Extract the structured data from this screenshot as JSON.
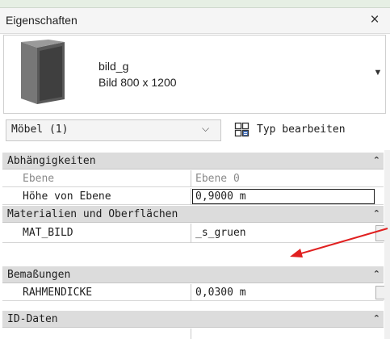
{
  "panel": {
    "title": "Eigenschaften",
    "close_glyph": "×"
  },
  "type_selector": {
    "family": "bild_g",
    "type": "Bild 800 x 1200",
    "dropdown_glyph": "▼"
  },
  "selection": {
    "filter_value": "Möbel (1)",
    "filter_arrow": "⌵",
    "edit_type_label": "Typ bearbeiten"
  },
  "sections": {
    "constraints": {
      "title": "Abhängigkeiten",
      "chevron": "⌃",
      "rows": [
        {
          "label": "Ebene",
          "value": "Ebene 0"
        },
        {
          "label": "Höhe von Ebene",
          "value": "0,9000 m"
        }
      ]
    },
    "materials": {
      "title": "Materialien und Oberflächen",
      "chevron": "⌃",
      "rows": [
        {
          "label": "MAT_BILD",
          "value": "_s_gruen"
        }
      ]
    },
    "dimensions": {
      "title": "Bemaßungen",
      "chevron": "⌃",
      "rows": [
        {
          "label": "RAHMENDICKE",
          "value": "0,0300 m"
        }
      ]
    },
    "id_data": {
      "title": "ID-Daten",
      "chevron": "⌃"
    }
  },
  "colors": {
    "annotation_arrow": "#e02020",
    "section_bg": "#dcdcdc"
  },
  "icons": {
    "preview": "picture-frame-preview-icon",
    "edit_type": "edit-type-icon",
    "close": "close-icon"
  }
}
